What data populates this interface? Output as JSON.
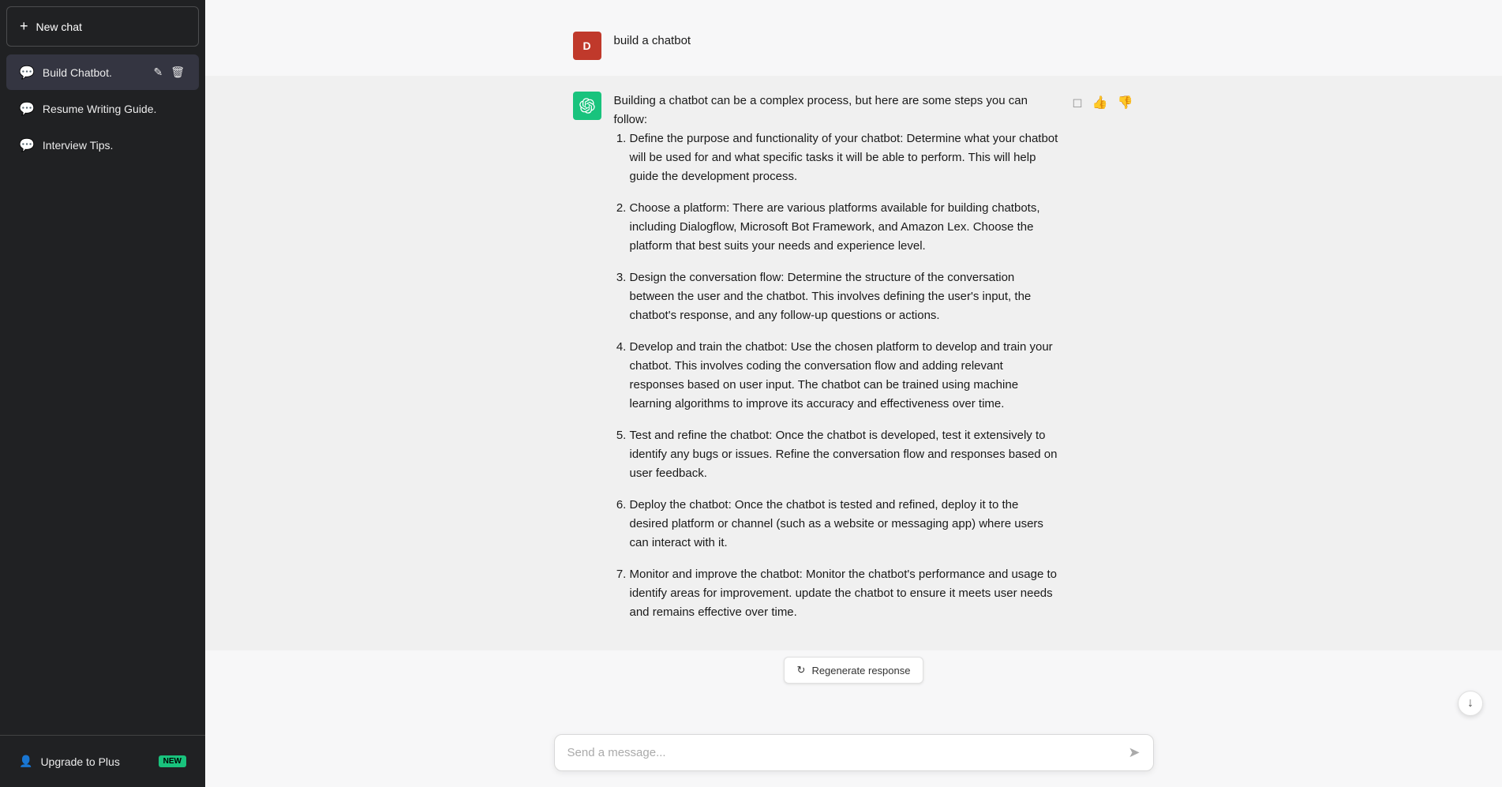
{
  "sidebar": {
    "new_chat_label": "New chat",
    "items": [
      {
        "id": "build-chatbot",
        "label": "Build Chatbot.",
        "active": true
      },
      {
        "id": "resume-writing",
        "label": "Resume Writing Guide.",
        "active": false
      },
      {
        "id": "interview-tips",
        "label": "Interview Tips.",
        "active": false
      }
    ],
    "upgrade_label": "Upgrade to Plus",
    "new_badge": "NEW"
  },
  "conversation": {
    "user_message": "build a chatbot",
    "user_avatar": "D",
    "ai_intro": "Building a chatbot can be a complex process, but here are some steps you can follow:",
    "steps": [
      {
        "number": 1,
        "text": "Define the purpose and functionality of your chatbot: Determine what your chatbot will be used for and what specific tasks it will be able to perform. This will help guide the development process."
      },
      {
        "number": 2,
        "text": "Choose a platform: There are various platforms available for building chatbots, including Dialogflow, Microsoft Bot Framework, and Amazon Lex. Choose the platform that best suits your needs and experience level."
      },
      {
        "number": 3,
        "text": "Design the conversation flow: Determine the structure of the conversation between the user and the chatbot. This involves defining the user's input, the chatbot's response, and any follow-up questions or actions."
      },
      {
        "number": 4,
        "text": "Develop and train the chatbot: Use the chosen platform to develop and train your chatbot. This involves coding the conversation flow and adding relevant responses based on user input. The chatbot can be trained using machine learning algorithms to improve its accuracy and effectiveness over time."
      },
      {
        "number": 5,
        "text": "Test and refine the chatbot: Once the chatbot is developed, test it extensively to identify any bugs or issues. Refine the conversation flow and responses based on user feedback."
      },
      {
        "number": 6,
        "text": "Deploy the chatbot: Once the chatbot is tested and refined, deploy it to the desired platform or channel (such as a website or messaging app) where users can interact with it."
      },
      {
        "number": 7,
        "text": "Monitor and improve the chatbot: Monitor the chatbot's performance and usage to identify areas for improvement. update the chatbot to ensure it meets user needs and remains effective over time."
      }
    ]
  },
  "input": {
    "placeholder": "Send a message..."
  },
  "regenerate": {
    "label": "Regenerate response"
  }
}
